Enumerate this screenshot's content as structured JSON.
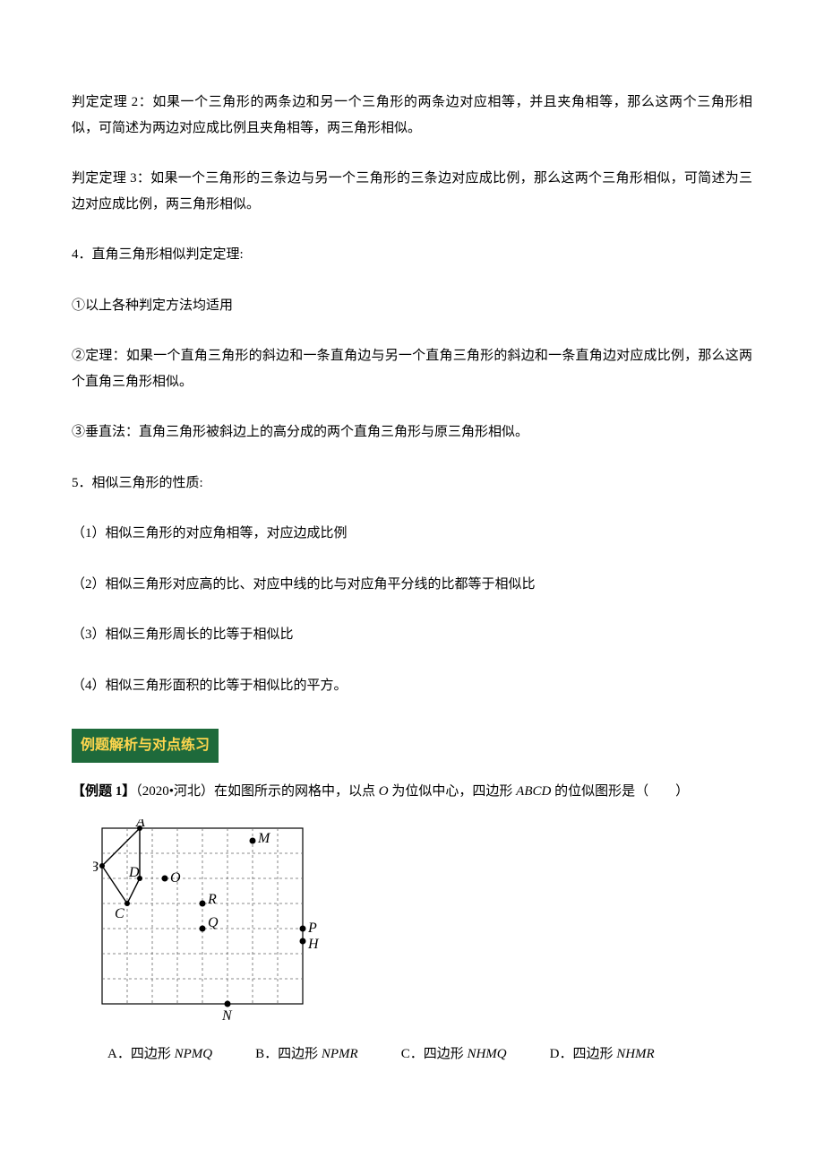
{
  "p1": "判定定理 2：如果一个三角形的两条边和另一个三角形的两条边对应相等，并且夹角相等，那么这两个三角形相似，可简述为两边对应成比例且夹角相等，两三角形相似。",
  "p2": "判定定理 3：如果一个三角形的三条边与另一个三角形的三条边对应成比例，那么这两个三角形相似，可简述为三边对应成比例，两三角形相似。",
  "p3": "4．直角三角形相似判定定理:",
  "p4": "①以上各种判定方法均适用",
  "p5": "②定理：如果一个直角三角形的斜边和一条直角边与另一个直角三角形的斜边和一条直角边对应成比例，那么这两个直角三角形相似。",
  "p6": "③垂直法：直角三角形被斜边上的高分成的两个直角三角形与原三角形相似。",
  "p7": "5．相似三角形的性质:",
  "p8": "（1）相似三角形的对应角相等，对应边成比例",
  "p9": "（2）相似三角形对应高的比、对应中线的比与对应角平分线的比都等于相似比",
  "p10": "（3）相似三角形周长的比等于相似比",
  "p11": "（4）相似三角形面积的比等于相似比的平方。",
  "banner": "例题解析与对点练习",
  "example": {
    "label": "【例题 1】",
    "source": "（2020•河北）",
    "text_before": "在如图所示的网格中，以点 ",
    "point": "O",
    "text_mid": " 为位似中心，四边形 ",
    "quad": "ABCD",
    "text_after": " 的位似图形是（　　）"
  },
  "figure": {
    "labels": {
      "A": "A",
      "B": "B",
      "C": "C",
      "D": "D",
      "O": "O",
      "M": "M",
      "R": "R",
      "Q": "Q",
      "P": "P",
      "H": "H",
      "N": "N"
    }
  },
  "options": {
    "A": {
      "label": "A．四边形 ",
      "val": "NPMQ"
    },
    "B": {
      "label": "B．四边形 ",
      "val": "NPMR"
    },
    "C": {
      "label": "C．四边形 ",
      "val": "NHMQ"
    },
    "D": {
      "label": "D．四边形 ",
      "val": "NHMR"
    }
  }
}
